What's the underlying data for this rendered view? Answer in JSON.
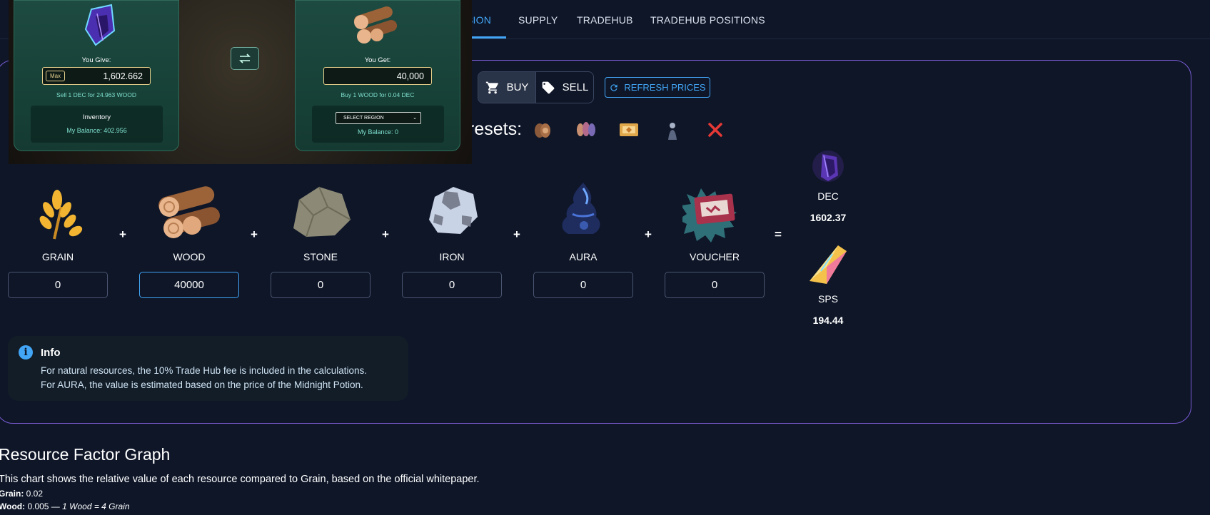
{
  "nav": {
    "tabs": [
      {
        "label": "SION"
      },
      {
        "label": "SUPPLY"
      },
      {
        "label": "TRADEHUB"
      },
      {
        "label": "TRADEHUB POSITIONS"
      }
    ]
  },
  "toolbar": {
    "buy_label": "BUY",
    "sell_label": "SELL",
    "refresh_label": "REFRESH PRICES"
  },
  "presets": {
    "label": "resets:"
  },
  "resources": [
    {
      "label": "GRAIN",
      "value": "0"
    },
    {
      "label": "WOOD",
      "value": "40000"
    },
    {
      "label": "STONE",
      "value": "0"
    },
    {
      "label": "IRON",
      "value": "0"
    },
    {
      "label": "AURA",
      "value": "0"
    },
    {
      "label": "VOUCHER",
      "value": "0"
    }
  ],
  "operators": {
    "plus": "+",
    "equals": "="
  },
  "outputs": [
    {
      "name": "DEC",
      "value": "1602.37"
    },
    {
      "name": "SPS",
      "value": "194.44"
    }
  ],
  "info": {
    "title": "Info",
    "line1": "For natural resources, the 10% Trade Hub fee is included in the calculations.",
    "line2": "For AURA, the value is estimated based on the price of the Midnight Potion."
  },
  "graph": {
    "title": "Resource Factor Graph",
    "description": "This chart shows the relative value of each resource compared to Grain, based on the official whitepaper.",
    "grain_label": "Grain:",
    "grain_value": " 0.02",
    "wood_label": "Wood:",
    "wood_value": " 0.005 — ",
    "wood_note": "1 Wood = 4 Grain"
  },
  "overlay": {
    "give_label": "You Give:",
    "give_max": "Max",
    "give_value": "1,602.662",
    "give_note": "Sell 1 DEC for 24.963 WOOD",
    "inv_title": "Inventory",
    "inv_balance": "My Balance: 402.956",
    "get_label": "You Get:",
    "get_value": "40,000",
    "get_note": "Buy 1 WOOD for 0.04 DEC",
    "region_select": "SELECT REGION",
    "get_balance": "My Balance: 0"
  },
  "colors": {
    "accent": "#42a5f5",
    "panel_border": "#7c5cd6",
    "background": "#0e1628"
  }
}
